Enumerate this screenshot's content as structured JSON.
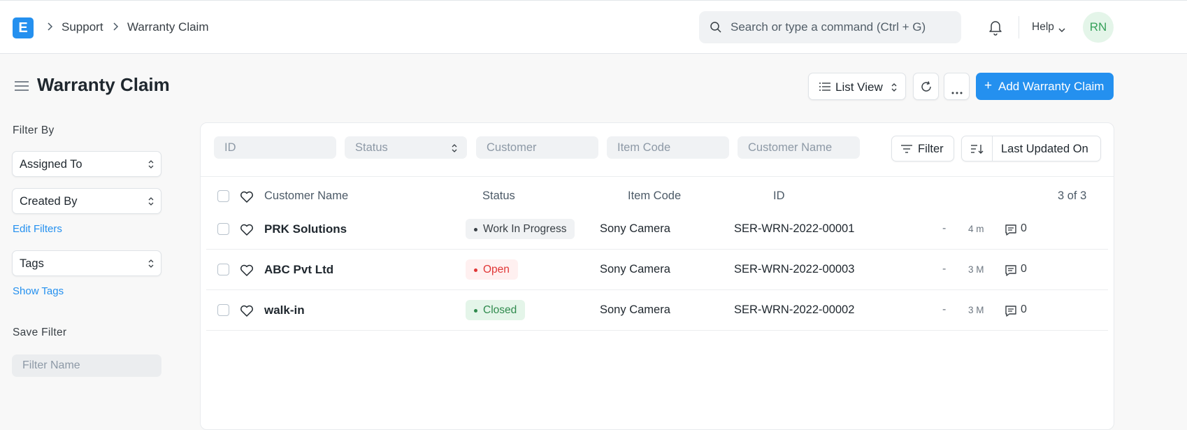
{
  "navbar": {
    "logo_letter": "E",
    "breadcrumbs": [
      "Support",
      "Warranty Claim"
    ],
    "search_placeholder": "Search or type a command (Ctrl + G)",
    "help_label": "Help",
    "avatar_initials": "RN"
  },
  "page": {
    "title": "Warranty Claim",
    "view_label": "List View",
    "add_label": "Add Warranty Claim"
  },
  "sidebar": {
    "filter_by_heading": "Filter By",
    "assigned_to": "Assigned To",
    "created_by": "Created By",
    "edit_filters": "Edit Filters",
    "tags": "Tags",
    "show_tags": "Show Tags",
    "save_filter_heading": "Save Filter",
    "filter_name_placeholder": "Filter Name"
  },
  "filters": {
    "id_placeholder": "ID",
    "status_placeholder": "Status",
    "customer_placeholder": "Customer",
    "item_code_placeholder": "Item Code",
    "customer_name_placeholder": "Customer Name",
    "filter_label": "Filter",
    "sort_label": "Last Updated On"
  },
  "table": {
    "headers": {
      "customer_name": "Customer Name",
      "status": "Status",
      "item_code": "Item Code",
      "id": "ID"
    },
    "count": "3 of 3",
    "rows": [
      {
        "customer_name": "PRK Solutions",
        "status": "Work In Progress",
        "status_color": "gray",
        "item_code": "Sony Camera",
        "id": "SER-WRN-2022-00001",
        "dash": "-",
        "modified": "4 m",
        "comments": "0"
      },
      {
        "customer_name": "ABC Pvt Ltd",
        "status": "Open",
        "status_color": "red",
        "item_code": "Sony Camera",
        "id": "SER-WRN-2022-00003",
        "dash": "-",
        "modified": "3 M",
        "comments": "0"
      },
      {
        "customer_name": "walk-in",
        "status": "Closed",
        "status_color": "green",
        "item_code": "Sony Camera",
        "id": "SER-WRN-2022-00002",
        "dash": "-",
        "modified": "3 M",
        "comments": "0"
      }
    ]
  },
  "colors": {
    "primary": "#2490ef",
    "avatar_bg": "#e4f5e9",
    "avatar_fg": "#36a15a"
  }
}
